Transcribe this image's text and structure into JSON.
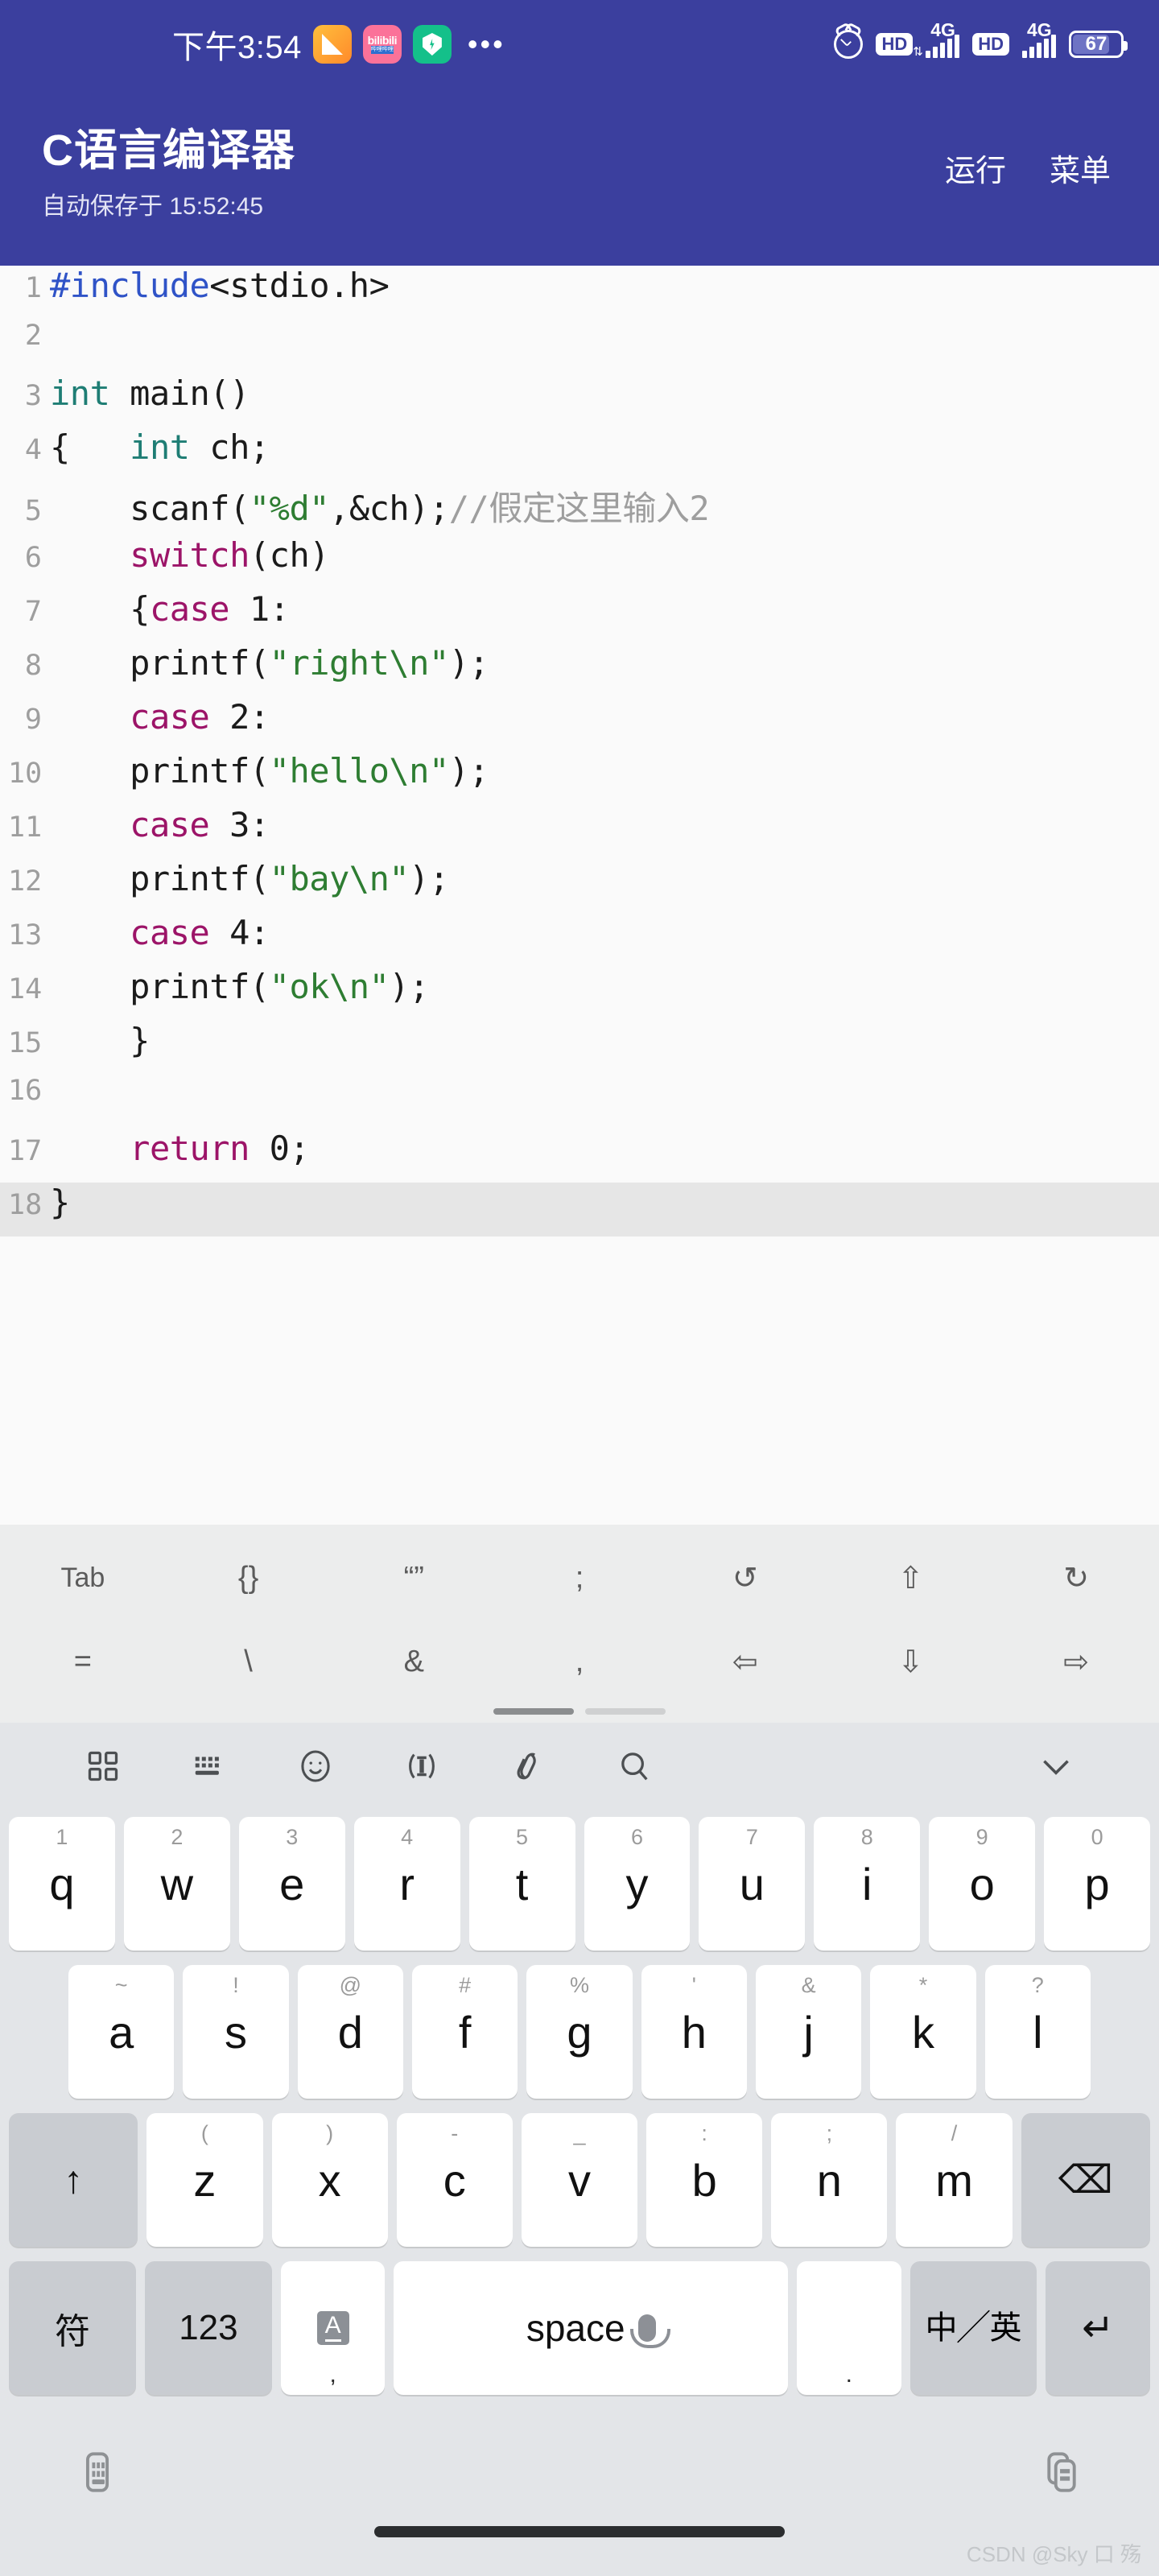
{
  "status_bar": {
    "time": "下午3:54",
    "tray_icons": [
      "note-app-icon",
      "bilibili-app-icon",
      "security-app-icon",
      "overflow-dots-icon"
    ],
    "alarm_icon": "alarm-icon",
    "sim1": {
      "hd": "HD",
      "network": "4G",
      "signal_bars": 5
    },
    "sim2": {
      "hd": "HD",
      "network": "4G",
      "signal_bars": 5
    },
    "battery": {
      "percent": "67",
      "level": 0.67
    }
  },
  "app_bar": {
    "title": "C语言编译器",
    "subtitle": "自动保存于 15:52:45",
    "run_label": "运行",
    "menu_label": "菜单"
  },
  "editor": {
    "active_line": 18,
    "lines": [
      {
        "n": "1",
        "tokens": [
          {
            "t": "#include",
            "c": "pre"
          },
          {
            "t": "<stdio.h>",
            "c": ""
          }
        ]
      },
      {
        "n": "2",
        "tokens": []
      },
      {
        "n": "3",
        "tokens": [
          {
            "t": "int",
            "c": "type"
          },
          {
            "t": " main()",
            "c": ""
          }
        ]
      },
      {
        "n": "4",
        "tokens": [
          {
            "t": "{   ",
            "c": ""
          },
          {
            "t": "int",
            "c": "type"
          },
          {
            "t": " ch;",
            "c": ""
          }
        ]
      },
      {
        "n": "5",
        "tokens": [
          {
            "t": "    scanf(",
            "c": ""
          },
          {
            "t": "\"%d\"",
            "c": "str"
          },
          {
            "t": ",&ch);",
            "c": ""
          },
          {
            "t": "//假定这里输入2",
            "c": "cmt"
          }
        ]
      },
      {
        "n": "6",
        "tokens": [
          {
            "t": "    ",
            "c": ""
          },
          {
            "t": "switch",
            "c": "kw"
          },
          {
            "t": "(ch)",
            "c": ""
          }
        ]
      },
      {
        "n": "7",
        "tokens": [
          {
            "t": "    {",
            "c": ""
          },
          {
            "t": "case",
            "c": "kw"
          },
          {
            "t": " 1:",
            "c": ""
          }
        ]
      },
      {
        "n": "8",
        "tokens": [
          {
            "t": "    printf(",
            "c": ""
          },
          {
            "t": "\"right\\n\"",
            "c": "str"
          },
          {
            "t": ");",
            "c": ""
          }
        ]
      },
      {
        "n": "9",
        "tokens": [
          {
            "t": "    ",
            "c": ""
          },
          {
            "t": "case",
            "c": "kw"
          },
          {
            "t": " 2:",
            "c": ""
          }
        ]
      },
      {
        "n": "10",
        "tokens": [
          {
            "t": "    printf(",
            "c": ""
          },
          {
            "t": "\"hello\\n\"",
            "c": "str"
          },
          {
            "t": ");",
            "c": ""
          }
        ]
      },
      {
        "n": "11",
        "tokens": [
          {
            "t": "    ",
            "c": ""
          },
          {
            "t": "case",
            "c": "kw"
          },
          {
            "t": " 3:",
            "c": ""
          }
        ]
      },
      {
        "n": "12",
        "tokens": [
          {
            "t": "    printf(",
            "c": ""
          },
          {
            "t": "\"bay\\n\"",
            "c": "str"
          },
          {
            "t": ");",
            "c": ""
          }
        ]
      },
      {
        "n": "13",
        "tokens": [
          {
            "t": "    ",
            "c": ""
          },
          {
            "t": "case",
            "c": "kw"
          },
          {
            "t": " 4:",
            "c": ""
          }
        ]
      },
      {
        "n": "14",
        "tokens": [
          {
            "t": "    printf(",
            "c": ""
          },
          {
            "t": "\"ok\\n\"",
            "c": "str"
          },
          {
            "t": ");",
            "c": ""
          }
        ]
      },
      {
        "n": "15",
        "tokens": [
          {
            "t": "    }",
            "c": ""
          }
        ]
      },
      {
        "n": "16",
        "tokens": []
      },
      {
        "n": "17",
        "tokens": [
          {
            "t": "    ",
            "c": ""
          },
          {
            "t": "return",
            "c": "kw"
          },
          {
            "t": " 0;",
            "c": ""
          }
        ]
      },
      {
        "n": "18",
        "tokens": [
          {
            "t": "}",
            "c": ""
          }
        ]
      }
    ]
  },
  "symbol_bar": {
    "row1": [
      {
        "label": "Tab",
        "name": "tab-key"
      },
      {
        "label": "{}",
        "name": "braces-key"
      },
      {
        "label": "“”",
        "name": "quotes-key"
      },
      {
        "label": ";",
        "name": "semicolon-key"
      },
      {
        "label": "↺",
        "name": "undo-icon"
      },
      {
        "label": "⇧",
        "name": "arrow-up-icon"
      },
      {
        "label": "↻",
        "name": "redo-icon"
      }
    ],
    "row2": [
      {
        "label": "=",
        "name": "equals-key"
      },
      {
        "label": "\\",
        "name": "backslash-key"
      },
      {
        "label": "&",
        "name": "ampersand-key"
      },
      {
        "label": ",",
        "name": "comma-key"
      },
      {
        "label": "⇦",
        "name": "arrow-left-icon"
      },
      {
        "label": "⇩",
        "name": "arrow-down-icon"
      },
      {
        "label": "⇨",
        "name": "arrow-right-icon"
      }
    ],
    "page_indicator": {
      "pages": 2,
      "current": 1
    }
  },
  "keyboard": {
    "toolbar": [
      "grid-icon",
      "keyboard-icon",
      "emoji-icon",
      "text-select-icon",
      "clipboard-icon",
      "search-icon",
      "chevron-down-icon"
    ],
    "row1": [
      {
        "sup": "1",
        "main": "q"
      },
      {
        "sup": "2",
        "main": "w"
      },
      {
        "sup": "3",
        "main": "e"
      },
      {
        "sup": "4",
        "main": "r"
      },
      {
        "sup": "5",
        "main": "t"
      },
      {
        "sup": "6",
        "main": "y"
      },
      {
        "sup": "7",
        "main": "u"
      },
      {
        "sup": "8",
        "main": "i"
      },
      {
        "sup": "9",
        "main": "o"
      },
      {
        "sup": "0",
        "main": "p"
      }
    ],
    "row2": [
      {
        "sup": "~",
        "main": "a"
      },
      {
        "sup": "!",
        "main": "s"
      },
      {
        "sup": "@",
        "main": "d"
      },
      {
        "sup": "#",
        "main": "f"
      },
      {
        "sup": "%",
        "main": "g"
      },
      {
        "sup": "'",
        "main": "h"
      },
      {
        "sup": "&",
        "main": "j"
      },
      {
        "sup": "*",
        "main": "k"
      },
      {
        "sup": "?",
        "main": "l"
      }
    ],
    "row3": [
      {
        "sup": "(",
        "main": "z"
      },
      {
        "sup": ")",
        "main": "x"
      },
      {
        "sup": "-",
        "main": "c"
      },
      {
        "sup": "_",
        "main": "v"
      },
      {
        "sup": ":",
        "main": "b"
      },
      {
        "sup": ";",
        "main": "n"
      },
      {
        "sup": "/",
        "main": "m"
      }
    ],
    "shift_label": "↑",
    "backspace_label": "⌫",
    "row4": {
      "symbols_label": "符",
      "numbers_label": "123",
      "caps_label": "A",
      "caps_sub": ",",
      "space_label": "space",
      "period_sub": ".",
      "lang_top": "中",
      "lang_bottom": "英",
      "enter_label": "↵"
    }
  },
  "nav_bar": {
    "hide_keyboard_icon": "hide-keyboard-icon",
    "switch_keyboard_icon": "switch-keyboard-icon",
    "home_indicator": "home-indicator"
  },
  "watermark": {
    "text": "CSDN @Sky 口 殇"
  }
}
